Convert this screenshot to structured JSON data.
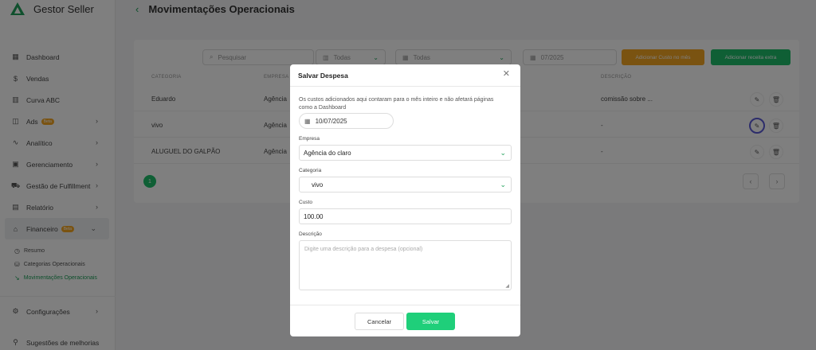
{
  "app": {
    "brand": "Gestor Seller"
  },
  "header": {
    "title": "Movimentações Operacionais"
  },
  "sidebar": {
    "items": [
      {
        "label": "Dashboard",
        "icon": "grid-icon"
      },
      {
        "label": "Vendas",
        "icon": "dollar-icon"
      },
      {
        "label": "Curva ABC",
        "icon": "building-icon"
      },
      {
        "label": "Ads",
        "badge": "Beta",
        "icon": "megaphone-icon"
      },
      {
        "label": "Analítico",
        "icon": "pulse-icon"
      },
      {
        "label": "Gerenciamento",
        "icon": "briefcase-icon"
      },
      {
        "label": "Gestão de Fulfillment",
        "icon": "truck-icon"
      },
      {
        "label": "Relatório",
        "icon": "report-icon"
      },
      {
        "label": "Financeiro",
        "badge": "Beta",
        "icon": "bank-icon"
      }
    ],
    "subitems": [
      {
        "label": "Resumo"
      },
      {
        "label": "Categorias Operacionais"
      },
      {
        "label": "Movimentações Operacionais"
      }
    ],
    "bottom": [
      {
        "label": "Configurações"
      },
      {
        "label": "Sugestões de melhorias"
      }
    ]
  },
  "filters": {
    "search_placeholder": "Pesquisar",
    "empresa_value": "Todas",
    "categoria_value": "Todas",
    "month_value": "07/2025",
    "add_cost_label": "Adicionar Custo no mês",
    "add_revenue_label": "Adicionar receita extra"
  },
  "table": {
    "headers": [
      "CATEGORIA",
      "EMPRESA",
      "DESCRIÇÃO"
    ],
    "rows": [
      {
        "categoria": "Eduardo",
        "empresa": "Agência",
        "descricao": "comissão sobre ..."
      },
      {
        "categoria": "vivo",
        "empresa": "Agência",
        "descricao": "-"
      },
      {
        "categoria": "ALUGUEL DO GALPÃO",
        "empresa": "Agência",
        "descricao": "-"
      }
    ],
    "page": "1"
  },
  "modal": {
    "title": "Salvar Despesa",
    "note": "Os custos adicionados aqui contaram para o mês inteiro e não afetará páginas como a Dashboard",
    "date": "10/07/2025",
    "empresa_label": "Empresa",
    "empresa_value": "Agência do claro",
    "categoria_label": "Categoria",
    "categoria_value": "vivo",
    "custo_label": "Custo",
    "custo_value": "100.00",
    "descricao_label": "Descrição",
    "descricao_placeholder": "Digite uma descrição para a despesa (opcional)",
    "cancel_label": "Cancelar",
    "save_label": "Salvar"
  },
  "colors": {
    "accent": "#1fbf6b",
    "warning": "#f5a623"
  }
}
